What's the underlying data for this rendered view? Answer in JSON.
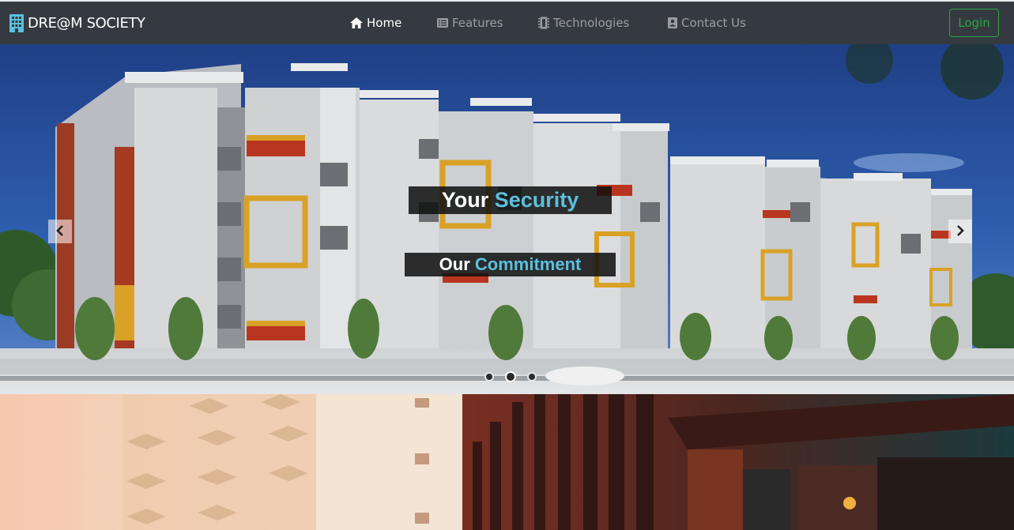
{
  "navbar": {
    "brand": "DRE@M SOCIETY",
    "brand_icon": "building-icon",
    "links": [
      {
        "label": "Home",
        "icon": "home-icon",
        "active": true
      },
      {
        "label": "Features",
        "icon": "list-icon",
        "active": false
      },
      {
        "label": "Technologies",
        "icon": "microchip-icon",
        "active": false
      },
      {
        "label": "Contact Us",
        "icon": "address-book-icon",
        "active": false
      }
    ],
    "login_label": "Login"
  },
  "carousel": {
    "caption_line1": {
      "lead": "Your ",
      "highlight": "Security"
    },
    "caption_line2": {
      "lead": "Our ",
      "highlight": "Commitment"
    },
    "prev_icon": "chevron-left-icon",
    "next_icon": "chevron-right-icon",
    "slide_count": 3,
    "active_slide": 2
  },
  "colors": {
    "navbar_bg": "#343a40",
    "accent_highlight": "#5bc0de",
    "login_green": "#28a745"
  }
}
